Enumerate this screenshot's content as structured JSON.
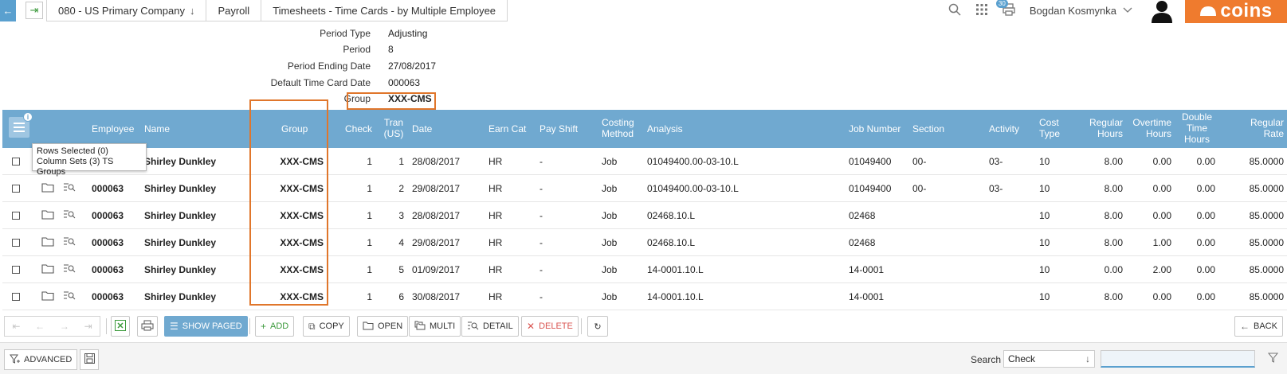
{
  "topbar": {
    "crumbs": [
      {
        "label": "080 - US Primary Company",
        "has_dropdown": true
      },
      {
        "label": "Payroll",
        "has_dropdown": false
      },
      {
        "label": "Timesheets - Time Cards - by Multiple Employee",
        "has_dropdown": false
      }
    ],
    "notifications_count": "30",
    "user_name": "Bogdan Kosmynka",
    "logo_text": "coins"
  },
  "fields": [
    {
      "label": "Period Type",
      "value": "Adjusting"
    },
    {
      "label": "Period",
      "value": "8"
    },
    {
      "label": "Period Ending Date",
      "value": "27/08/2017"
    },
    {
      "label": "Default Time Card Date",
      "value": "000063"
    },
    {
      "label": "Group",
      "value": "XXX-CMS"
    }
  ],
  "grid": {
    "headers": {
      "employee": "Employee",
      "name": "Name",
      "group": "Group",
      "check": "Check",
      "tran": "Tran (US)",
      "date": "Date",
      "earn_cat": "Earn Cat",
      "pay_shift": "Pay Shift",
      "costing_method": "Costing Method",
      "analysis": "Analysis",
      "job_number": "Job Number",
      "section": "Section",
      "activity": "Activity",
      "cost_type": "Cost Type",
      "regular_hours": "Regular Hours",
      "overtime_hours": "Overtime Hours",
      "double_time_hours": "Double Time Hours",
      "regular_rate": "Regular Rate"
    },
    "tooltip": {
      "line1": "Rows Selected (0)",
      "line2": "Column Sets (3) TS Groups"
    },
    "rows": [
      {
        "employee": "000063",
        "name": "Shirley Dunkley",
        "group": "XXX-CMS",
        "check": "1",
        "tran": "1",
        "date": "28/08/2017",
        "earn_cat": "HR",
        "pay_shift": "-",
        "costing_method": "Job",
        "analysis": "01049400.00-03-10.L",
        "job_number": "01049400",
        "section": "00-",
        "activity": "03-",
        "cost_type": "10",
        "regular_hours": "8.00",
        "overtime_hours": "0.00",
        "double_time_hours": "0.00",
        "regular_rate": "85.0000"
      },
      {
        "employee": "000063",
        "name": "Shirley Dunkley",
        "group": "XXX-CMS",
        "check": "1",
        "tran": "2",
        "date": "29/08/2017",
        "earn_cat": "HR",
        "pay_shift": "-",
        "costing_method": "Job",
        "analysis": "01049400.00-03-10.L",
        "job_number": "01049400",
        "section": "00-",
        "activity": "03-",
        "cost_type": "10",
        "regular_hours": "8.00",
        "overtime_hours": "0.00",
        "double_time_hours": "0.00",
        "regular_rate": "85.0000"
      },
      {
        "employee": "000063",
        "name": "Shirley Dunkley",
        "group": "XXX-CMS",
        "check": "1",
        "tran": "3",
        "date": "28/08/2017",
        "earn_cat": "HR",
        "pay_shift": "-",
        "costing_method": "Job",
        "analysis": "02468.10.L",
        "job_number": "02468",
        "section": "",
        "activity": "",
        "cost_type": "10",
        "regular_hours": "8.00",
        "overtime_hours": "0.00",
        "double_time_hours": "0.00",
        "regular_rate": "85.0000"
      },
      {
        "employee": "000063",
        "name": "Shirley Dunkley",
        "group": "XXX-CMS",
        "check": "1",
        "tran": "4",
        "date": "29/08/2017",
        "earn_cat": "HR",
        "pay_shift": "-",
        "costing_method": "Job",
        "analysis": "02468.10.L",
        "job_number": "02468",
        "section": "",
        "activity": "",
        "cost_type": "10",
        "regular_hours": "8.00",
        "overtime_hours": "1.00",
        "double_time_hours": "0.00",
        "regular_rate": "85.0000"
      },
      {
        "employee": "000063",
        "name": "Shirley Dunkley",
        "group": "XXX-CMS",
        "check": "1",
        "tran": "5",
        "date": "01/09/2017",
        "earn_cat": "HR",
        "pay_shift": "-",
        "costing_method": "Job",
        "analysis": "14-0001.10.L",
        "job_number": "14-0001",
        "section": "",
        "activity": "",
        "cost_type": "10",
        "regular_hours": "0.00",
        "overtime_hours": "2.00",
        "double_time_hours": "0.00",
        "regular_rate": "85.0000"
      },
      {
        "employee": "000063",
        "name": "Shirley Dunkley",
        "group": "XXX-CMS",
        "check": "1",
        "tran": "6",
        "date": "30/08/2017",
        "earn_cat": "HR",
        "pay_shift": "-",
        "costing_method": "Job",
        "analysis": "14-0001.10.L",
        "job_number": "14-0001",
        "section": "",
        "activity": "",
        "cost_type": "10",
        "regular_hours": "8.00",
        "overtime_hours": "0.00",
        "double_time_hours": "0.00",
        "regular_rate": "85.0000"
      }
    ]
  },
  "toolbar": {
    "show_paged": "SHOW PAGED",
    "add": "ADD",
    "copy": "COPY",
    "open": "OPEN",
    "multi": "MULTI",
    "detail": "DETAIL",
    "delete": "DELETE",
    "back": "BACK"
  },
  "bottombar": {
    "advanced": "ADVANCED",
    "search_label": "Search",
    "search_field": "Check",
    "search_value": ""
  },
  "colors": {
    "accent": "#70a9d0",
    "highlight": "#e0762b",
    "brand": "#ef7b2e"
  }
}
